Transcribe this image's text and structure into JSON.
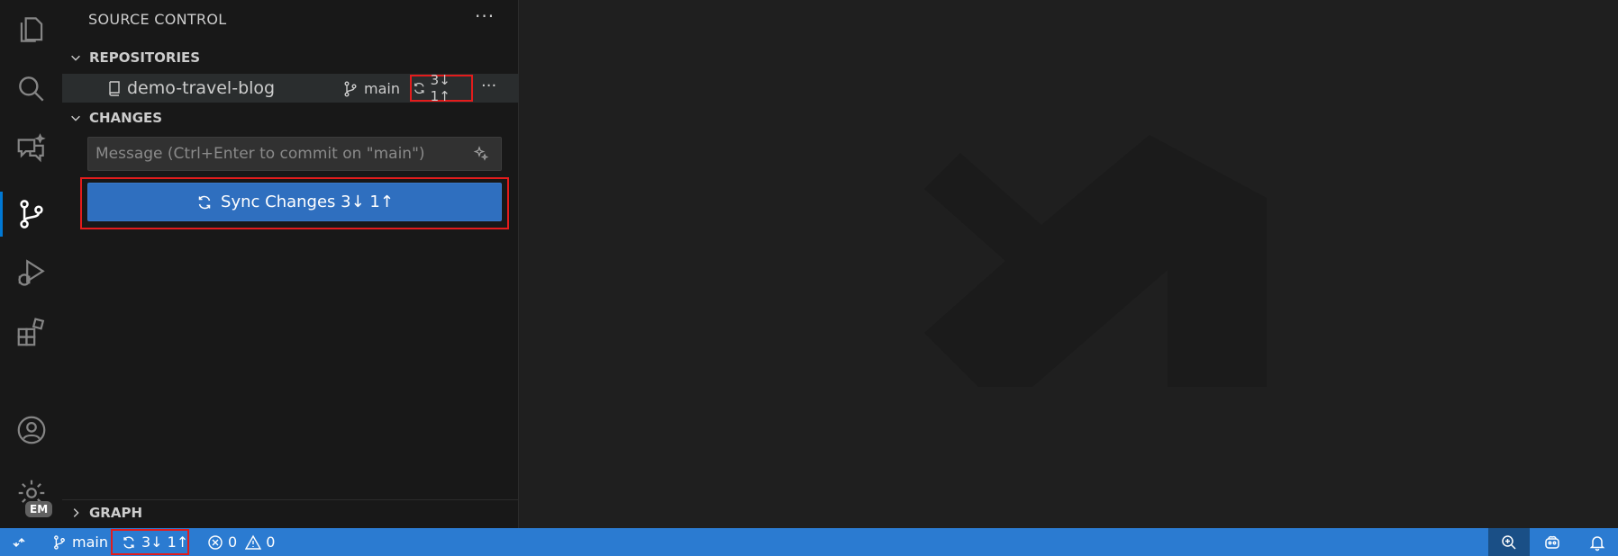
{
  "sidebar": {
    "title": "SOURCE CONTROL",
    "more_label": "···",
    "repositories": {
      "header": "REPOSITORIES",
      "repo_name": "demo-travel-blog",
      "branch": "main",
      "sync_badge": "3↓ 1↑",
      "more_label": "···"
    },
    "changes": {
      "header": "CHANGES",
      "message_placeholder": "Message (Ctrl+Enter to commit on \"main\")",
      "sync_button": "Sync Changes 3↓ 1↑"
    },
    "graph": {
      "header": "GRAPH"
    }
  },
  "activity_bar": {
    "items": [
      "explorer-icon",
      "search-icon",
      "chat-icon",
      "source-control-icon",
      "run-debug-icon",
      "extensions-icon",
      "account-icon",
      "settings-icon"
    ],
    "account_badge": "EM"
  },
  "status_bar": {
    "branch": "main",
    "sync": "3↓ 1↑",
    "errors": "0",
    "warnings": "0"
  },
  "colors": {
    "accent": "#0078d4",
    "status_bar": "#2b7bd1",
    "sync_button": "#2f6fbf",
    "highlight": "#e31c1c"
  }
}
